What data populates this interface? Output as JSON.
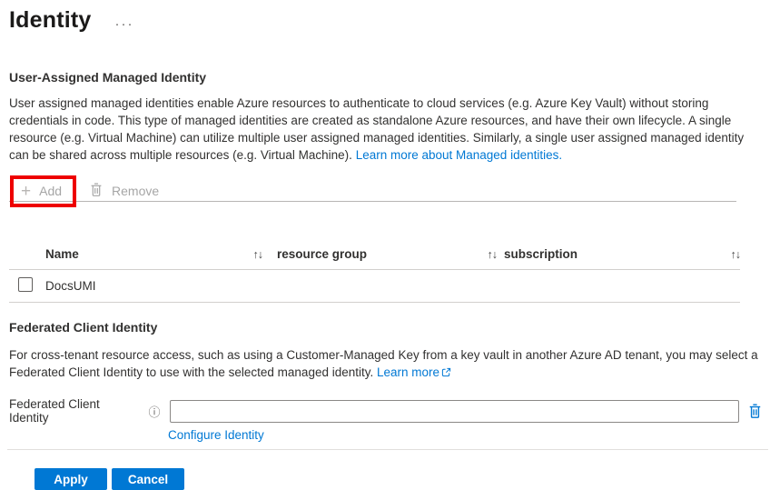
{
  "page": {
    "title": "Identity",
    "more_options_icon": "···"
  },
  "uami": {
    "heading": "User-Assigned Managed Identity",
    "description": "User assigned managed identities enable Azure resources to authenticate to cloud services (e.g. Azure Key Vault) without storing credentials in code. This type of managed identities are created as standalone Azure resources, and have their own lifecycle. A single resource (e.g. Virtual Machine) can utilize multiple user assigned managed identities. Similarly, a single user assigned managed identity can be shared across multiple resources (e.g. Virtual Machine).",
    "learn_more_link": "Learn more about Managed identities.",
    "toolbar": {
      "add_icon": "+",
      "add_label": "Add",
      "remove_label": "Remove"
    },
    "table": {
      "sort_icon": "↑↓",
      "columns": [
        {
          "label": "Name"
        },
        {
          "label": "resource group"
        },
        {
          "label": "subscription"
        }
      ],
      "rows": [
        {
          "name": "DocsUMI",
          "resource_group": "",
          "subscription": "",
          "selected": false
        }
      ]
    }
  },
  "federated": {
    "heading": "Federated Client Identity",
    "description": "For cross-tenant resource access, such as using a Customer-Managed Key from a key vault in another Azure AD tenant, you may select a Federated Client Identity to use with the selected managed identity.",
    "learn_more_link": "Learn more",
    "field_label": "Federated Client Identity",
    "info_icon": "ⓘ",
    "input_value": "",
    "input_placeholder": "",
    "configure_link": "Configure Identity"
  },
  "footer": {
    "apply_label": "Apply",
    "cancel_label": "Cancel"
  },
  "colors": {
    "accent_blue": "#0078d4",
    "link_blue": "#0078d4",
    "highlight_red": "#ee0000",
    "disabled_gray": "#a6a6a6",
    "text_dark": "#323130"
  }
}
